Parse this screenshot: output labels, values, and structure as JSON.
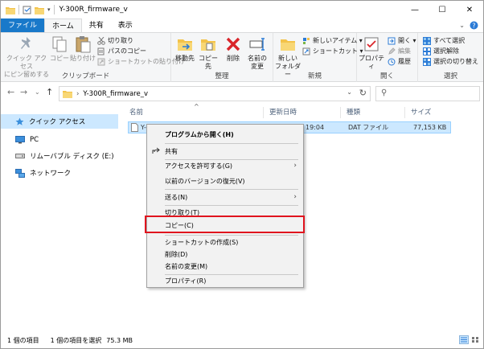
{
  "window": {
    "title": "Y-300R_firmware_v",
    "controls": {
      "minimize": "—",
      "maximize": "☐",
      "close": "✕"
    }
  },
  "ribbon_tabs": {
    "file": "ファイル",
    "home": "ホーム",
    "share": "共有",
    "view": "表示"
  },
  "ribbon": {
    "clipboard": {
      "label": "クリップボード",
      "pin": "クイック アクセス\nにピン留めする",
      "copy": "コピー",
      "paste": "貼り付け",
      "cut": "切り取り",
      "copy_path": "パスのコピー",
      "paste_shortcut": "ショートカットの貼り付け"
    },
    "organize": {
      "label": "整理",
      "move_to": "移動先",
      "copy_to": "コピー先",
      "delete": "削除",
      "rename": "名前の\n変更"
    },
    "new": {
      "label": "新規",
      "new_folder": "新しい\nフォルダー",
      "new_item": "新しいアイテム ▾",
      "easy_access": "ショートカット ▾"
    },
    "open": {
      "label": "開く",
      "properties": "プロパティ",
      "open": "開く ▾",
      "edit": "編集",
      "history": "履歴"
    },
    "select": {
      "label": "選択",
      "select_all": "すべて選択",
      "select_none": "選択解除",
      "invert": "選択の切り替え"
    }
  },
  "address": {
    "path": "Y-300R_firmware_v",
    "search_placeholder": ""
  },
  "nav_pane": {
    "items": [
      {
        "label": "クイック アクセス",
        "icon": "star-icon",
        "selected": true
      },
      {
        "label": "PC",
        "icon": "pc-icon",
        "selected": false
      },
      {
        "label": "リムーバブル ディスク (E:)",
        "icon": "drive-icon",
        "selected": false
      },
      {
        "label": "ネットワーク",
        "icon": "network-icon",
        "selected": false
      }
    ]
  },
  "columns": {
    "name": "名前",
    "modified": "更新日時",
    "type": "種類",
    "size": "サイズ"
  },
  "files": [
    {
      "name": "Y-",
      "modified": "19:04",
      "type": "DAT ファイル",
      "size": "77,153 KB",
      "selected": true
    }
  ],
  "context_menu": {
    "items": [
      {
        "label": "プログラムから開く(H)",
        "bold": true
      },
      {
        "label": "共有",
        "icon": "share-icon"
      },
      {
        "label": "アクセスを許可する(G)",
        "submenu": true
      },
      {
        "label": "以前のバージョンの復元(V)"
      },
      {
        "label": "送る(N)",
        "submenu": true
      },
      {
        "label": "切り取り(T)"
      },
      {
        "label": "コピー(C)",
        "highlighted": true
      },
      {
        "label": "ショートカットの作成(S)"
      },
      {
        "label": "削除(D)"
      },
      {
        "label": "名前の変更(M)"
      },
      {
        "label": "プロパティ(R)"
      }
    ],
    "highlight_color": "#e0141e"
  },
  "status": {
    "item_count": "1 個の項目",
    "selection": "1 個の項目を選択",
    "selection_size": "75.3 MB"
  },
  "colors": {
    "file_tab": "#1979ca",
    "selection": "#cce8ff",
    "selection_border": "#99d1ff",
    "column_header": "#4c607a"
  }
}
